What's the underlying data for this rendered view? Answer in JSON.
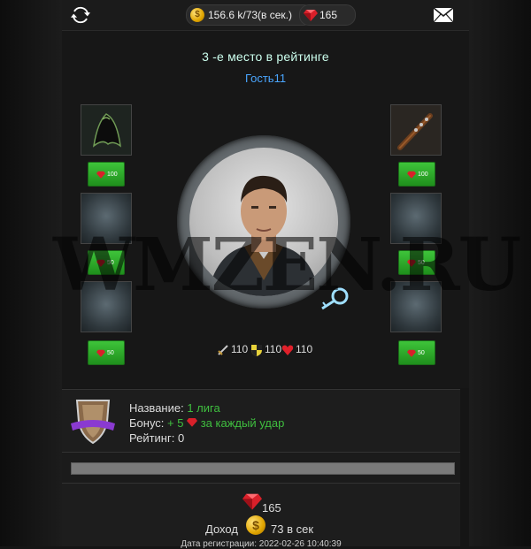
{
  "header": {
    "income_text": "156.6 k/73(в сек.)",
    "gems": "165",
    "coin_symbol": "$"
  },
  "profile": {
    "rank_text": "3 -е место в рейтинге",
    "username": "Гость11"
  },
  "slots": {
    "left": [
      {
        "price": "100",
        "filled": true,
        "item": "cloak"
      },
      {
        "price": "50",
        "filled": false
      },
      {
        "price": "50",
        "filled": false
      }
    ],
    "right": [
      {
        "price": "100",
        "filled": true,
        "item": "club"
      },
      {
        "price": "50",
        "filled": false
      },
      {
        "price": "50",
        "filled": false
      }
    ]
  },
  "stats": {
    "attack": "110",
    "defense": "110",
    "health": "110"
  },
  "league": {
    "name_label": "Название:",
    "name_value": "1 лига",
    "bonus_label": "Бонус:",
    "bonus_value": "+ 5",
    "bonus_suffix": "за каждый удар",
    "rating_label": "Рейтинг:",
    "rating_value": "0"
  },
  "footer": {
    "gems": "165",
    "income_label": "Доход",
    "coin_symbol": "$",
    "income_value": "73 в сек",
    "reg_date": "Дата регистрации: 2022-02-26 10:40:39"
  },
  "watermark": "WMZEN.RU",
  "colors": {
    "accent_blue": "#4aa6ff",
    "button_green": "#2fae2b",
    "bonus_green": "#3fbf3f",
    "gem_red": "#d9202a"
  }
}
